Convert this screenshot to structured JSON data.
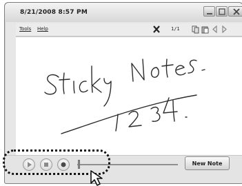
{
  "window": {
    "title": "8/21/2008 8:57 PM",
    "buttons": [
      "minimize",
      "maximize",
      "close"
    ]
  },
  "menubar": {
    "menus": [
      "Tools",
      "Help"
    ],
    "page_indicator": "1/1",
    "toolbar_icons": [
      "delete-icon",
      "copy-icon",
      "paste-icon",
      "previous-page-icon",
      "next-page-icon"
    ]
  },
  "note": {
    "handwriting_line1": "Sticky Notes.",
    "handwriting_line2": "1 2 3 4."
  },
  "recorder": {
    "controls": [
      "play",
      "stop",
      "record"
    ],
    "volume_level": 0.0
  },
  "actions": {
    "new_note_label": "New Note"
  },
  "colors": {
    "window_frame": "#e7e7e7",
    "canvas": "#ffffff",
    "ink": "#2a2a2a",
    "highlight_dotted": "#111111"
  }
}
